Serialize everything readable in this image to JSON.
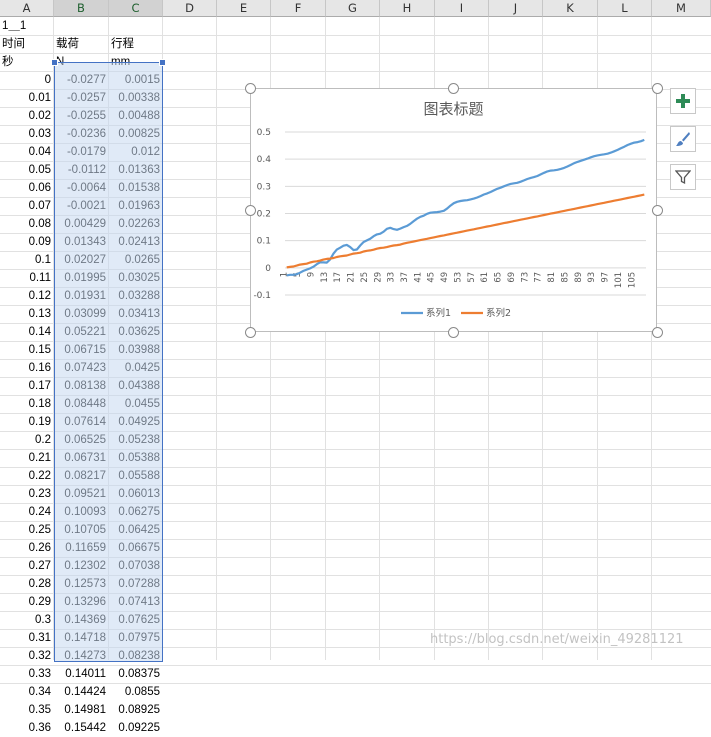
{
  "columns": [
    "A",
    "B",
    "C",
    "D",
    "E",
    "F",
    "G",
    "H",
    "I",
    "J",
    "K",
    "L",
    "M"
  ],
  "header_rows": {
    "row1": {
      "A": "1＿1"
    },
    "row2": {
      "A": "时间",
      "B": "载荷",
      "C": "行程"
    },
    "row3": {
      "A": "秒",
      "B": "N",
      "C": "mm"
    }
  },
  "data_rows": [
    [
      "0",
      "-0.0277",
      "0.0015"
    ],
    [
      "0.01",
      "-0.0257",
      "0.00338"
    ],
    [
      "0.02",
      "-0.0255",
      "0.00488"
    ],
    [
      "0.03",
      "-0.0236",
      "0.00825"
    ],
    [
      "0.04",
      "-0.0179",
      "0.012"
    ],
    [
      "0.05",
      "-0.0112",
      "0.01363"
    ],
    [
      "0.06",
      "-0.0064",
      "0.01538"
    ],
    [
      "0.07",
      "-0.0021",
      "0.01963"
    ],
    [
      "0.08",
      "0.00429",
      "0.02263"
    ],
    [
      "0.09",
      "0.01343",
      "0.02413"
    ],
    [
      "0.1",
      "0.02027",
      "0.0265"
    ],
    [
      "0.11",
      "0.01995",
      "0.03025"
    ],
    [
      "0.12",
      "0.01931",
      "0.03288"
    ],
    [
      "0.13",
      "0.03099",
      "0.03413"
    ],
    [
      "0.14",
      "0.05221",
      "0.03625"
    ],
    [
      "0.15",
      "0.06715",
      "0.03988"
    ],
    [
      "0.16",
      "0.07423",
      "0.0425"
    ],
    [
      "0.17",
      "0.08138",
      "0.04388"
    ],
    [
      "0.18",
      "0.08448",
      "0.0455"
    ],
    [
      "0.19",
      "0.07614",
      "0.04925"
    ],
    [
      "0.2",
      "0.06525",
      "0.05238"
    ],
    [
      "0.21",
      "0.06731",
      "0.05388"
    ],
    [
      "0.22",
      "0.08217",
      "0.05588"
    ],
    [
      "0.23",
      "0.09521",
      "0.06013"
    ],
    [
      "0.24",
      "0.10093",
      "0.06275"
    ],
    [
      "0.25",
      "0.10705",
      "0.06425"
    ],
    [
      "0.26",
      "0.11659",
      "0.06675"
    ],
    [
      "0.27",
      "0.12302",
      "0.07038"
    ],
    [
      "0.28",
      "0.12573",
      "0.07288"
    ],
    [
      "0.29",
      "0.13296",
      "0.07413"
    ],
    [
      "0.3",
      "0.14369",
      "0.07625"
    ],
    [
      "0.31",
      "0.14718",
      "0.07975"
    ],
    [
      "0.32",
      "0.14273",
      "0.08238"
    ],
    [
      "0.33",
      "0.14011",
      "0.08375"
    ],
    [
      "0.34",
      "0.14424",
      "0.0855"
    ],
    [
      "0.35",
      "0.14981",
      "0.08925"
    ],
    [
      "0.36",
      "0.15442",
      "0.09225"
    ]
  ],
  "chart": {
    "title": "图表标题",
    "side_buttons": [
      "plus-icon",
      "brush-icon",
      "filter-icon"
    ]
  },
  "chart_data": {
    "type": "line",
    "title": "图表标题",
    "xlabel": "",
    "ylabel": "",
    "x_tick_labels": [
      "1",
      "5",
      "9",
      "13",
      "17",
      "21",
      "25",
      "29",
      "33",
      "37",
      "41",
      "45",
      "49",
      "53",
      "57",
      "61",
      "65",
      "69",
      "73",
      "77",
      "81",
      "85",
      "89",
      "93",
      "97",
      "101",
      "105"
    ],
    "x_count": 108,
    "ylim": [
      -0.1,
      0.5
    ],
    "y_ticks": [
      "0.5",
      "0.4",
      "0.3",
      "0.2",
      "0.1",
      "0",
      "-0.1"
    ],
    "grid": true,
    "legend_position": "bottom",
    "series": [
      {
        "name": "系列1",
        "color": "#5b9bd5",
        "values": [
          -0.0277,
          -0.0257,
          -0.0255,
          -0.0236,
          -0.0179,
          -0.0112,
          -0.0064,
          -0.0021,
          0.00429,
          0.01343,
          0.02027,
          0.01995,
          0.01931,
          0.03099,
          0.05221,
          0.06715,
          0.07423,
          0.08138,
          0.08448,
          0.07614,
          0.06525,
          0.06731,
          0.08217,
          0.09521,
          0.10093,
          0.10705,
          0.11659,
          0.12302,
          0.12573,
          0.13296,
          0.14369,
          0.14718,
          0.14273,
          0.14011,
          0.14424,
          0.14981,
          0.15442,
          0.162,
          0.172,
          0.181,
          0.188,
          0.192,
          0.199,
          0.203,
          0.204,
          0.205,
          0.207,
          0.21,
          0.218,
          0.229,
          0.238,
          0.243,
          0.246,
          0.248,
          0.249,
          0.252,
          0.255,
          0.259,
          0.264,
          0.27,
          0.274,
          0.279,
          0.285,
          0.291,
          0.295,
          0.3,
          0.305,
          0.309,
          0.311,
          0.313,
          0.317,
          0.322,
          0.327,
          0.331,
          0.334,
          0.338,
          0.344,
          0.35,
          0.355,
          0.358,
          0.359,
          0.361,
          0.364,
          0.368,
          0.373,
          0.379,
          0.385,
          0.39,
          0.394,
          0.398,
          0.402,
          0.407,
          0.411,
          0.414,
          0.416,
          0.418,
          0.42,
          0.424,
          0.429,
          0.434,
          0.44,
          0.446,
          0.452,
          0.457,
          0.461,
          0.463,
          0.466,
          0.471
        ]
      },
      {
        "name": "系列2",
        "color": "#ed7d31",
        "values": [
          0.0015,
          0.00338,
          0.00488,
          0.00825,
          0.012,
          0.01363,
          0.01538,
          0.01963,
          0.02263,
          0.02413,
          0.0265,
          0.03025,
          0.03288,
          0.03413,
          0.03625,
          0.03988,
          0.0425,
          0.04388,
          0.0455,
          0.04925,
          0.05238,
          0.05388,
          0.05588,
          0.06013,
          0.06275,
          0.06425,
          0.06675,
          0.07038,
          0.07288,
          0.07413,
          0.07625,
          0.07975,
          0.08238,
          0.08375,
          0.0855,
          0.08925,
          0.09225,
          0.0945,
          0.097,
          0.0995,
          0.102,
          0.1045,
          0.107,
          0.1095,
          0.112,
          0.1145,
          0.117,
          0.1195,
          0.122,
          0.1245,
          0.127,
          0.1295,
          0.132,
          0.1345,
          0.137,
          0.1395,
          0.142,
          0.1445,
          0.147,
          0.1495,
          0.152,
          0.1545,
          0.157,
          0.1595,
          0.162,
          0.1645,
          0.167,
          0.1695,
          0.172,
          0.1745,
          0.177,
          0.1795,
          0.182,
          0.1845,
          0.187,
          0.1895,
          0.192,
          0.1945,
          0.197,
          0.1995,
          0.202,
          0.2045,
          0.207,
          0.2095,
          0.212,
          0.2145,
          0.217,
          0.2195,
          0.222,
          0.2245,
          0.227,
          0.2295,
          0.232,
          0.2345,
          0.237,
          0.2395,
          0.242,
          0.2445,
          0.247,
          0.2495,
          0.252,
          0.2545,
          0.257,
          0.2595,
          0.262,
          0.2645,
          0.267,
          0.2695
        ]
      }
    ]
  },
  "watermark": "https://blog.csdn.net/weixin_49281121"
}
